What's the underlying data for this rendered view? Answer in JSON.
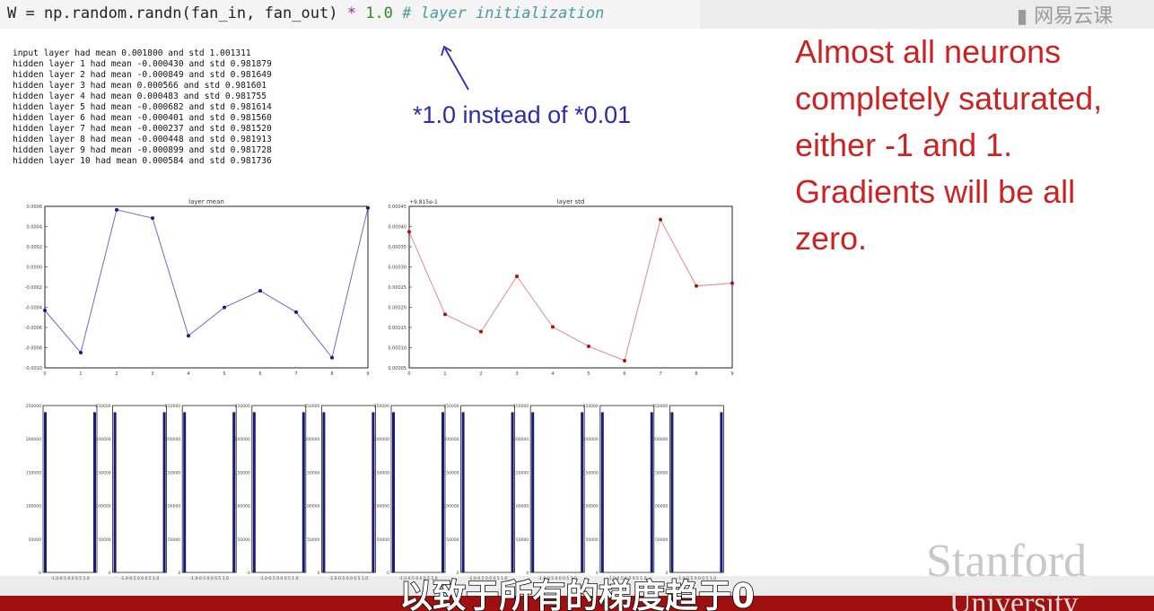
{
  "code": {
    "prefix": "W = np.random.randn(fan_in, fan_out) ",
    "op": "*",
    "num": " 1.0",
    "comment": " # layer initialization"
  },
  "stats_lines": [
    "input layer had mean 0.001800 and std 1.001311",
    "hidden layer 1 had mean -0.000430 and std 0.981879",
    "hidden layer 2 had mean -0.000849 and std 0.981649",
    "hidden layer 3 had mean 0.000566 and std 0.981601",
    "hidden layer 4 had mean 0.000483 and std 0.981755",
    "hidden layer 5 had mean -0.000682 and std 0.981614",
    "hidden layer 6 had mean -0.000401 and std 0.981560",
    "hidden layer 7 had mean -0.000237 and std 0.981520",
    "hidden layer 8 had mean -0.000448 and std 0.981913",
    "hidden layer 9 had mean -0.000899 and std 0.981728",
    "hidden layer 10 had mean 0.000584 and std 0.981736"
  ],
  "annotation_blue": "*1.0 instead of *0.01",
  "annotation_red": "Almost all neurons completely saturated, either -1 and 1. Gradients will be all zero.",
  "subtitle": "以致于所有的梯度趋于0",
  "watermark": {
    "logo": "▮ 网易云课",
    "stanford": "Stanford",
    "university": "University"
  },
  "colors": {
    "mean_line": "#6a6ad0",
    "mean_point": "#1a1a8a",
    "std_line": "#e08a8a",
    "std_point": "#b01010",
    "hist_bar": "#1a1a7a",
    "red_text": "#cc2222",
    "blue_text": "#2b2bb0"
  },
  "chart_data": [
    {
      "type": "line",
      "title": "layer mean",
      "x": [
        0,
        1,
        2,
        3,
        4,
        5,
        6,
        7,
        8,
        9
      ],
      "xticks": [
        "0",
        "1",
        "2",
        "3",
        "4",
        "5",
        "6",
        "7",
        "8",
        "9"
      ],
      "values": [
        -0.00043,
        -0.000849,
        0.000566,
        0.000483,
        -0.000682,
        -0.000401,
        -0.000237,
        -0.000448,
        -0.000899,
        0.000584
      ],
      "ylim": [
        -0.001,
        0.0006
      ],
      "yticks": [
        "0.0006",
        "0.0004",
        "0.0002",
        "0.0000",
        "-0.0002",
        "-0.0004",
        "-0.0006",
        "-0.0008",
        "-0.0010"
      ]
    },
    {
      "type": "line",
      "title": "layer std",
      "offset_label": "+9.815e-1",
      "x": [
        0,
        1,
        2,
        3,
        4,
        5,
        6,
        7,
        8,
        9
      ],
      "xticks": [
        "0",
        "1",
        "2",
        "3",
        "4",
        "5",
        "6",
        "7",
        "8",
        "9"
      ],
      "values": [
        0.981879,
        0.981649,
        0.981601,
        0.981755,
        0.981614,
        0.98156,
        0.98152,
        0.981913,
        0.981728,
        0.981736
      ],
      "ylim": [
        0.9815,
        0.98195
      ],
      "yticks": [
        "0.00045",
        "0.00040",
        "0.00035",
        "0.00030",
        "0.00025",
        "0.00020",
        "0.00015",
        "0.00010",
        "0.00005"
      ]
    },
    {
      "type": "bar",
      "subplots": 10,
      "categories": [
        "-1",
        "1"
      ],
      "values": [
        240000,
        240000
      ],
      "ylim": [
        0,
        250000
      ],
      "yticks": [
        "250000",
        "200000",
        "150000",
        "100000",
        "50000",
        "0"
      ],
      "xticks": "-1.0-0.5 0.0 0.5 1.0"
    }
  ]
}
